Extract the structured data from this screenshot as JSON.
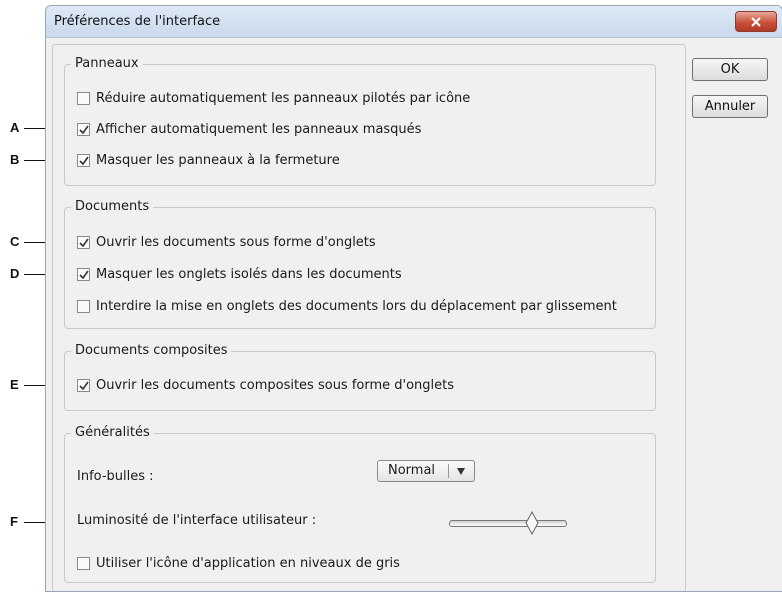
{
  "window": {
    "title": "Préférences de l'interface"
  },
  "buttons": {
    "ok": "OK",
    "cancel": "Annuler"
  },
  "groups": {
    "panneaux": {
      "legend": "Panneaux",
      "items": [
        {
          "label": "Réduire automatiquement les panneaux pilotés par icône",
          "checked": false
        },
        {
          "label": "Afficher automatiquement les panneaux masqués",
          "checked": true
        },
        {
          "label": "Masquer les panneaux à la fermeture",
          "checked": true
        }
      ]
    },
    "documents": {
      "legend": "Documents",
      "items": [
        {
          "label": "Ouvrir les documents sous forme d'onglets",
          "checked": true
        },
        {
          "label": "Masquer les onglets isolés dans les documents",
          "checked": true
        },
        {
          "label": "Interdire la mise en onglets des documents lors du déplacement par glissement",
          "checked": false
        }
      ]
    },
    "composites": {
      "legend": "Documents composites",
      "items": [
        {
          "label": "Ouvrir les documents composites sous forme d'onglets",
          "checked": true
        }
      ]
    },
    "generalites": {
      "legend": "Généralités",
      "tooltip_label": "Info-bulles :",
      "tooltip_value": "Normal",
      "brightness_label": "Luminosité de l'interface utilisateur :",
      "brightness_level": 0.75,
      "grayscale_label": "Utiliser l'icône d'application en niveaux de gris",
      "grayscale_checked": false
    }
  },
  "callouts": [
    "A",
    "B",
    "C",
    "D",
    "E",
    "F"
  ]
}
